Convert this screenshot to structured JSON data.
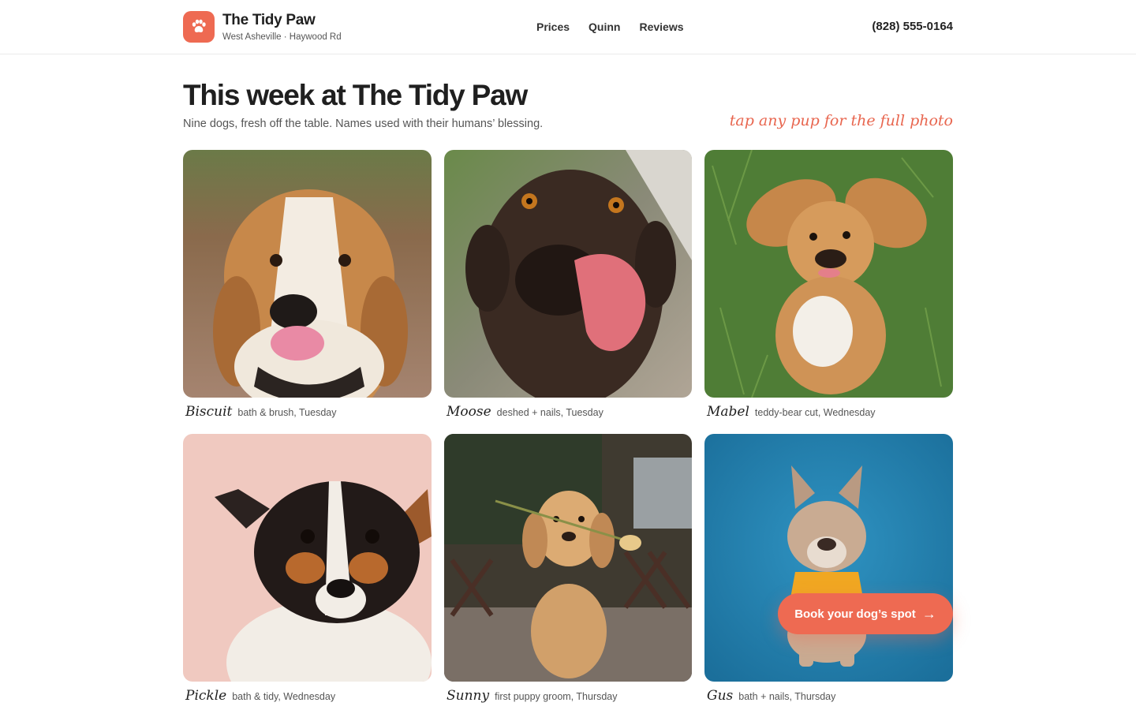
{
  "brand": {
    "name": "The Tidy Paw",
    "location": "West Asheville · Haywood Rd",
    "logo_icon": "paw-icon",
    "accent": "#ee6a52"
  },
  "nav": [
    {
      "label": "Prices"
    },
    {
      "label": "Quinn"
    },
    {
      "label": "Reviews"
    }
  ],
  "phone": "(828) 555-0164",
  "hero": {
    "title": "This week at The Tidy Paw",
    "subtitle": "Nine dogs, fresh off the table. Names used with their humans’ blessing.",
    "hint": "tap any pup for the full photo"
  },
  "dogs": [
    {
      "name": "Biscuit",
      "note": "bath & brush, Tuesday"
    },
    {
      "name": "Moose",
      "note": "deshed + nails, Tuesday"
    },
    {
      "name": "Mabel",
      "note": "teddy-bear cut, Wednesday"
    },
    {
      "name": "Pickle",
      "note": "bath & tidy, Wednesday"
    },
    {
      "name": "Sunny",
      "note": "first puppy groom, Thursday"
    },
    {
      "name": "Gus",
      "note": "bath + nails, Thursday"
    }
  ],
  "cta": {
    "label": "Book your dog’s spot",
    "icon": "arrow-right-icon"
  }
}
